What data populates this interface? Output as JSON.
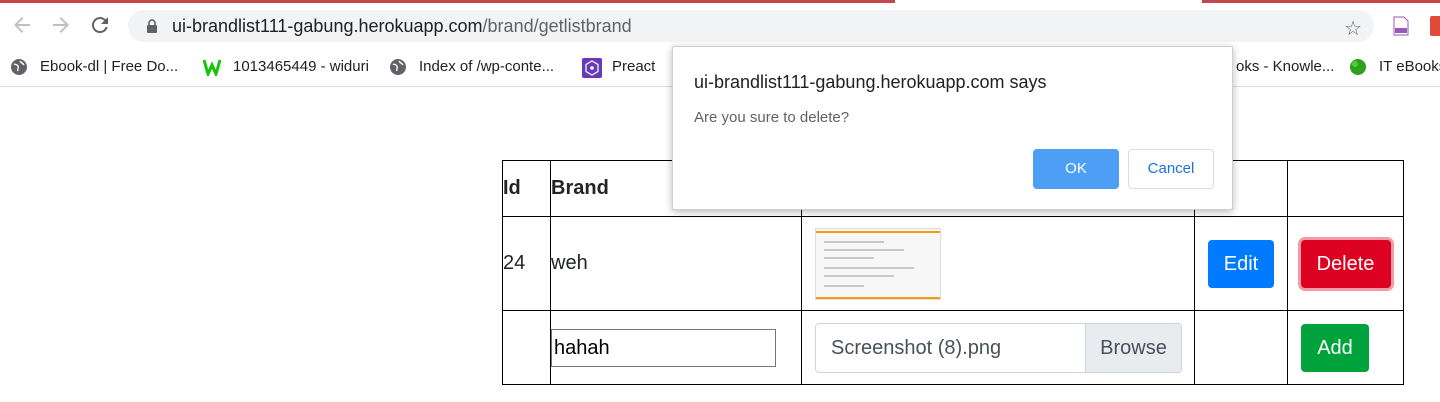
{
  "browser": {
    "url_host": "ui-brandlist111-gabung.herokuapp.com",
    "url_path": "/brand/getlistbrand"
  },
  "bookmarks": [
    {
      "label": "Ebook-dl | Free Do...",
      "icon": "globe-icon"
    },
    {
      "label": "1013465449 - widuri",
      "icon": "w-logo-icon"
    },
    {
      "label": "Index of /wp-conte...",
      "icon": "globe-icon"
    },
    {
      "label": "Preact",
      "icon": "preact-icon"
    },
    {
      "label": "oks - Knowle...",
      "icon": "none"
    },
    {
      "label": "IT eBooks",
      "icon": "green-blob-icon"
    }
  ],
  "table": {
    "headers": {
      "id": "Id",
      "brand": "Brand"
    },
    "row": {
      "id": "24",
      "brand": "weh",
      "edit_label": "Edit",
      "delete_label": "Delete"
    },
    "new_row": {
      "brand_value": "hahah",
      "file_name": "Screenshot (8).png",
      "browse_label": "Browse",
      "add_label": "Add"
    }
  },
  "dialog": {
    "title": "ui-brandlist111-gabung.herokuapp.com says",
    "message": "Are you sure to delete?",
    "ok_label": "OK",
    "cancel_label": "Cancel"
  },
  "colors": {
    "edit": "#007bff",
    "delete": "#dc0021",
    "add": "#00a23c",
    "ok": "#4c9ff5"
  }
}
